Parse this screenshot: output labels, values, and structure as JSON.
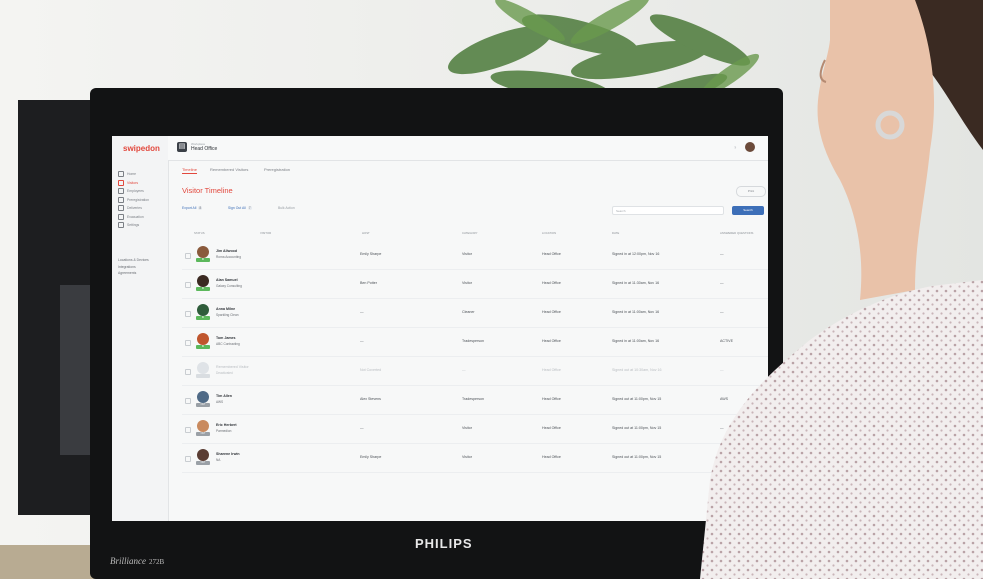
{
  "photo": {
    "monitor_brand": "PHILIPS",
    "monitor_model": "Brilliance",
    "monitor_model_number": "272B"
  },
  "app": {
    "brand": "swipedon",
    "location_label": "Workplace",
    "location_name": "Head Office",
    "sidebar": {
      "items": [
        {
          "label": "Home",
          "icon": "home-icon",
          "active": false
        },
        {
          "label": "Visitors",
          "icon": "visitor-icon",
          "active": true
        },
        {
          "label": "Employees",
          "icon": "employee-icon",
          "active": false
        },
        {
          "label": "Preregistration",
          "icon": "calendar-icon",
          "active": false
        },
        {
          "label": "Deliveries",
          "icon": "package-icon",
          "active": false
        },
        {
          "label": "Evacuation",
          "icon": "alert-icon",
          "active": false
        },
        {
          "label": "Settings",
          "icon": "gear-icon",
          "active": false
        }
      ],
      "links": [
        "Locations & Devices",
        "Integrations",
        "Agreements"
      ]
    },
    "tabs": [
      {
        "label": "Timeline",
        "active": true
      },
      {
        "label": "Remembered Visitors",
        "active": false
      },
      {
        "label": "Preregistration",
        "active": false
      }
    ],
    "page_title": "Visitor Timeline",
    "top_button": "Print",
    "toolbar": {
      "export_label": "Export All",
      "export_count": "8",
      "signout_label": "Sign Out All",
      "signout_count": "7",
      "bulk_label": "Bulk Action"
    },
    "search": {
      "placeholder": "Search",
      "button": "Search"
    },
    "columns": [
      "STATUS",
      "VISITOR",
      "HOST",
      "CATEGORY",
      "LOCATION",
      "DATE",
      "ANSWERED QUESTIONS"
    ],
    "rows": [
      {
        "name": "Jim Allwood",
        "company": "Roma Accounting",
        "host": "Emily Sharpe",
        "category": "Visitor",
        "location": "Head Office",
        "date": "Signed in at 12:00pm, Nov 16",
        "extra": "—",
        "badge": "IN",
        "badge_color": "#5cb85c",
        "avatar_color": "#8a5a3c",
        "faded": false
      },
      {
        "name": "Alan Samuel",
        "company": "Galaxy Consulting",
        "host": "Ben Potter",
        "category": "Visitor",
        "location": "Head Office",
        "date": "Signed in at 11:30am, Nov 16",
        "extra": "—",
        "badge": "IN",
        "badge_color": "#5cb85c",
        "avatar_color": "#3b2a22",
        "faded": false
      },
      {
        "name": "Anna Milne",
        "company": "Sparkling Clean",
        "host": "—",
        "category": "Cleaner",
        "location": "Head Office",
        "date": "Signed in at 11:00am, Nov 16",
        "extra": "—",
        "badge": "IN",
        "badge_color": "#5cb85c",
        "avatar_color": "#2f5d3b",
        "faded": false
      },
      {
        "name": "Tom James",
        "company": "ABC Contracting",
        "host": "—",
        "category": "Tradesperson",
        "location": "Head Office",
        "date": "Signed in at 11:00am, Nov 16",
        "extra": "ACTIVE",
        "badge": "IN",
        "badge_color": "#5cb85c",
        "avatar_color": "#c0562e",
        "faded": false
      },
      {
        "name": "Remembered Visitor",
        "company": "Deactivated",
        "host": "Not Coverted",
        "category": "—",
        "location": "Head Office",
        "date": "Signed out at 10:30am, Nov 16",
        "extra": "—",
        "badge": "",
        "badge_color": "#d9dde1",
        "avatar_color": "#dfe3e7",
        "faded": true
      },
      {
        "name": "Tim Allen",
        "company": "AWS",
        "host": "Alex Stevens",
        "category": "Tradesperson",
        "location": "Head Office",
        "date": "Signed out at 11:00pm, Nov 15",
        "extra": "AWS",
        "badge": "OUT",
        "badge_color": "#9aa0a6",
        "avatar_color": "#4f6a86",
        "faded": false
      },
      {
        "name": "Eric Herbert",
        "company": "Parmedion",
        "host": "—",
        "category": "Visitor",
        "location": "Head Office",
        "date": "Signed out at 11:00pm, Nov 15",
        "extra": "—",
        "badge": "OUT",
        "badge_color": "#9aa0a6",
        "avatar_color": "#c98a5e",
        "faded": false
      },
      {
        "name": "Sharene Irwin",
        "company": "NA",
        "host": "Emily Sharpe",
        "category": "Visitor",
        "location": "Head Office",
        "date": "Signed out at 11:00pm, Nov 15",
        "extra": "—",
        "badge": "OUT",
        "badge_color": "#9aa0a6",
        "avatar_color": "#5a3d33",
        "faded": false
      }
    ]
  }
}
